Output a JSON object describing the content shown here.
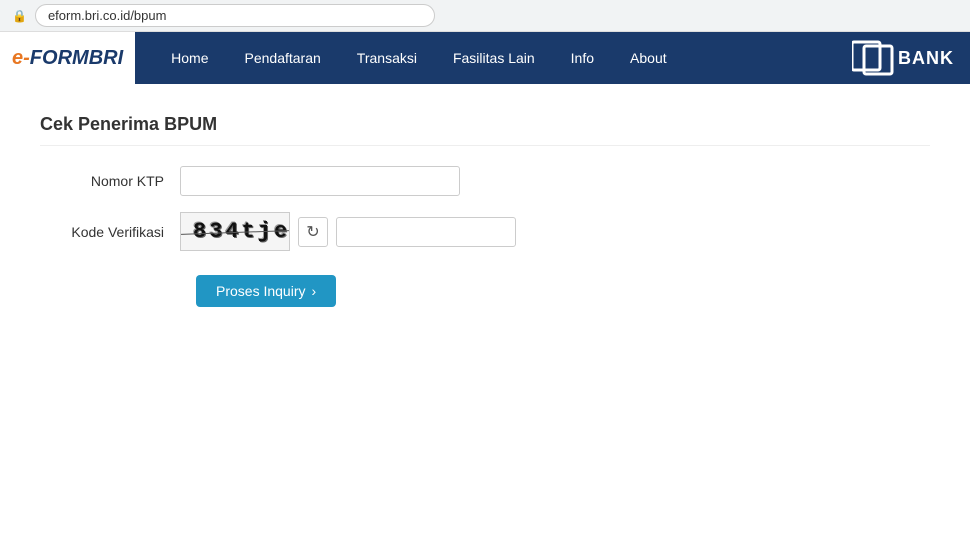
{
  "browser": {
    "url": "eform.bri.co.id/bpum",
    "lock_icon": "🔒"
  },
  "navbar": {
    "brand": {
      "e": "e-",
      "form": "FORM",
      "bri": "BRI"
    },
    "nav_items": [
      {
        "label": "Home",
        "href": "#"
      },
      {
        "label": "Pendaftaran",
        "href": "#"
      },
      {
        "label": "Transaksi",
        "href": "#"
      },
      {
        "label": "Fasilitas Lain",
        "href": "#"
      },
      {
        "label": "Info",
        "href": "#"
      },
      {
        "label": "About",
        "href": "#"
      }
    ],
    "bank_logo_text": "BANK"
  },
  "page": {
    "title": "Cek Penerima BPUM",
    "form": {
      "nomor_ktp_label": "Nomor KTP",
      "kode_verifikasi_label": "Kode Verifikasi",
      "captcha_text": "834tje",
      "btn_label": "Proses Inquiry",
      "btn_arrow": "›"
    }
  }
}
